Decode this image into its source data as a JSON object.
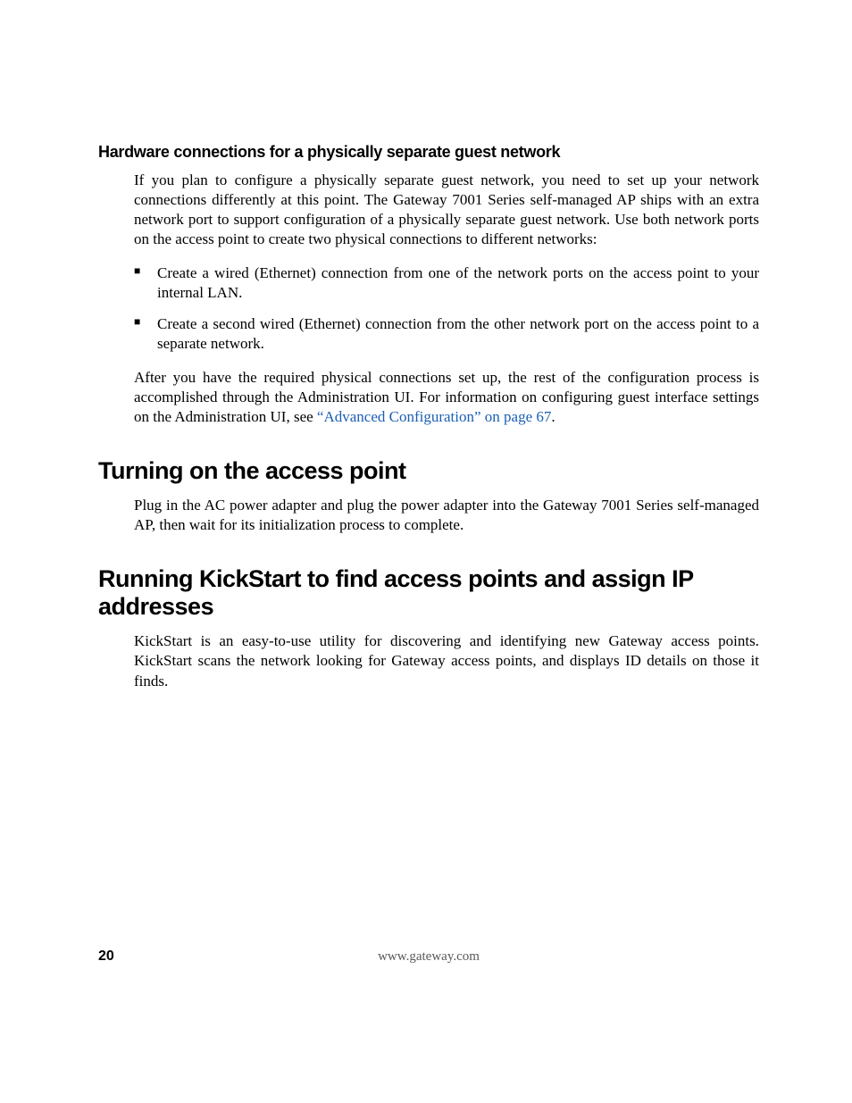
{
  "section1": {
    "subheading": "Hardware connections for a physically separate guest network",
    "intro": "If you plan to configure a physically separate guest network, you need to set up your network connections differently at this point. The Gateway 7001 Series self-managed AP ships with an extra network port to support configuration of a physically separate guest network. Use both network ports on the access point to create two physical connections to different networks:",
    "bullets": [
      "Create a wired (Ethernet) connection from one of the network ports on the access point to your internal LAN.",
      "Create a second wired (Ethernet) connection from the other network port on the access point to a separate network."
    ],
    "after_prefix": "After you have the required physical connections set up, the rest of the configuration process is accomplished through the Administration UI. For information on configuring guest interface settings on the Administration UI, see ",
    "crossref": "“Advanced Configuration” on page 67",
    "after_suffix": "."
  },
  "section2": {
    "heading": "Turning on the access point",
    "body": "Plug in the AC power adapter and plug the power adapter into the Gateway 7001 Series self-managed AP, then wait for its initialization process to complete."
  },
  "section3": {
    "heading": "Running KickStart to find access points and assign IP addresses",
    "body": "KickStart is an easy-to-use utility for discovering and identifying new Gateway access points. KickStart scans the network looking for Gateway access points, and displays ID details on those it finds."
  },
  "footer": {
    "page_number": "20",
    "url": "www.gateway.com"
  }
}
